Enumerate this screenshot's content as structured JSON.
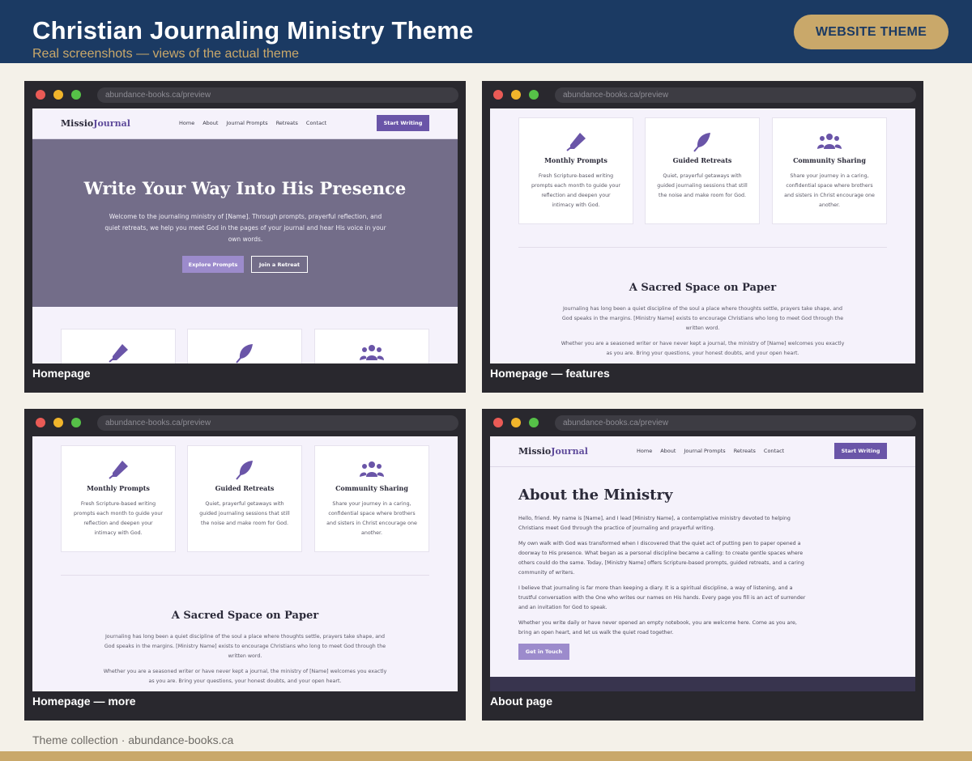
{
  "banner": {
    "title": "Christian Journaling Ministry Theme",
    "subtitle": "Real screenshots — views of the actual theme",
    "badge": "WEBSITE THEME"
  },
  "colors": {
    "banner_bg": "#1b3a63",
    "gold": "#c9a86a",
    "card_bg": "#29282e",
    "purple": "#6a55a8",
    "hero_bg": "#736d89"
  },
  "url": "abundance-books.ca/preview",
  "site": {
    "logo_part1": "Missio",
    "logo_part2": "Journal",
    "nav": [
      "Home",
      "About",
      "Journal Prompts",
      "Retreats",
      "Contact"
    ],
    "cta": "Start Writing"
  },
  "hero": {
    "title": "Write Your Way Into His Presence",
    "text": "Welcome to the journaling ministry of [Name]. Through prompts, prayerful reflection, and quiet retreats, we help you meet God in the pages of your journal and hear His voice in your own words.",
    "btn_primary": "Explore Prompts",
    "btn_secondary": "Join a Retreat"
  },
  "features": [
    {
      "icon": "pen-icon",
      "title": "Monthly Prompts",
      "text": "Fresh Scripture-based writing prompts each month to guide your reflection and deepen your intimacy with God."
    },
    {
      "icon": "feather-icon",
      "title": "Guided Retreats",
      "text": "Quiet, prayerful getaways with guided journaling sessions that still the noise and make room for God."
    },
    {
      "icon": "users-icon",
      "title": "Community Sharing",
      "text": "Share your journey in a caring, confidential space where brothers and sisters in Christ encourage one another."
    }
  ],
  "sacred": {
    "title": "A Sacred Space on Paper",
    "p1": "Journaling has long been a quiet discipline of the soul a place where thoughts settle, prayers take shape, and God speaks in the margins. [Ministry Name] exists to encourage Christians who long to meet God through the written word.",
    "p2": "Whether you are a seasoned writer or have never kept a journal, the ministry of [Name] welcomes you exactly as you are. Bring your questions, your honest doubts, and your open heart."
  },
  "about": {
    "title": "About the Ministry",
    "paragraphs": [
      "Hello, friend. My name is [Name], and I lead [Ministry Name], a contemplative ministry devoted to helping Christians meet God through the practice of journaling and prayerful writing.",
      "My own walk with God was transformed when I discovered that the quiet act of putting pen to paper opened a doorway to His presence. What began as a personal discipline became a calling: to create gentle spaces where others could do the same. Today, [Ministry Name] offers Scripture-based prompts, guided retreats, and a caring community of writers.",
      "I believe that journaling is far more than keeping a diary. It is a spiritual discipline, a way of listening, and a trustful conversation with the One who writes our names on His hands. Every page you fill is an act of surrender and an invitation for God to speak.",
      "Whether you write daily or have never opened an empty notebook, you are welcome here. Come as you are, bring an open heart, and let us walk the quiet road together."
    ],
    "button": "Get in Touch"
  },
  "captions": [
    "Homepage",
    "Homepage — features",
    "Homepage — more",
    "About page"
  ],
  "footer": "Theme collection · abundance-books.ca"
}
